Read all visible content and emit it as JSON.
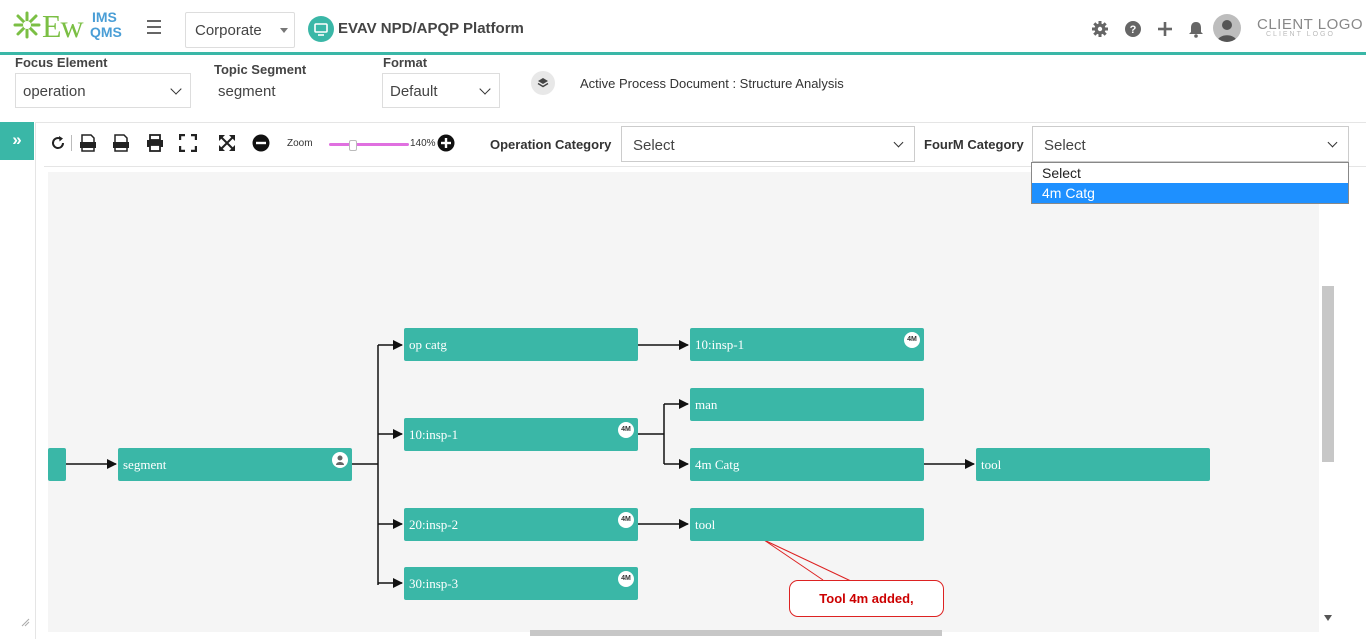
{
  "header": {
    "logo_ew": "Ew",
    "logo_ims": "IMS",
    "logo_qms": "QMS",
    "org_select": "Corporate",
    "platform_title": "EVAV NPD/APQP Platform",
    "client_logo": "CLIENT LOGO",
    "client_logo_sub": "CLIENT LOGO"
  },
  "filters": {
    "focus_label": "Focus Element",
    "focus_value": "operation",
    "topic_label": "Topic Segment",
    "topic_value": "segment",
    "format_label": "Format",
    "format_value": "Default",
    "active_doc": "Active Process Document : Structure Analysis"
  },
  "toolbar": {
    "expand_label": "»",
    "zoom_label": "Zoom",
    "zoom_value": "140%",
    "zoom_level_percent": 140,
    "op_cat_label": "Operation Category",
    "op_cat_value": "Select",
    "fourm_label": "FourM Category",
    "fourm_value": "Select",
    "fourm_options": [
      "Select",
      "4m Catg"
    ],
    "fourm_highlighted": "4m Catg"
  },
  "diagram": {
    "nodes": [
      {
        "id": "segment",
        "label": "segment",
        "badge": "",
        "icon": "user-icon"
      },
      {
        "id": "op-catg",
        "label": "op catg",
        "badge": ""
      },
      {
        "id": "insp1-mid",
        "label": "10:insp-1",
        "badge": "4M"
      },
      {
        "id": "insp2",
        "label": "20:insp-2",
        "badge": "4M"
      },
      {
        "id": "insp3",
        "label": "30:insp-3",
        "badge": "4M"
      },
      {
        "id": "insp1-right",
        "label": "10:insp-1",
        "badge": "4M"
      },
      {
        "id": "man",
        "label": "man",
        "badge": ""
      },
      {
        "id": "catg4m",
        "label": "4m Catg",
        "badge": ""
      },
      {
        "id": "tool-mid",
        "label": "tool",
        "badge": ""
      },
      {
        "id": "tool-right",
        "label": "tool",
        "badge": ""
      }
    ],
    "edges": [
      [
        "segment",
        "op-catg"
      ],
      [
        "segment",
        "insp1-mid"
      ],
      [
        "segment",
        "insp2"
      ],
      [
        "segment",
        "insp3"
      ],
      [
        "op-catg",
        "insp1-right"
      ],
      [
        "insp1-mid",
        "man"
      ],
      [
        "insp1-mid",
        "catg4m"
      ],
      [
        "catg4m",
        "tool-right"
      ],
      [
        "insp2",
        "tool-mid"
      ]
    ],
    "callout": "Tool 4m added,"
  },
  "colors": {
    "accent": "#3ab7a7",
    "callout_border": "#dd2222",
    "highlight": "#1e90ff"
  }
}
